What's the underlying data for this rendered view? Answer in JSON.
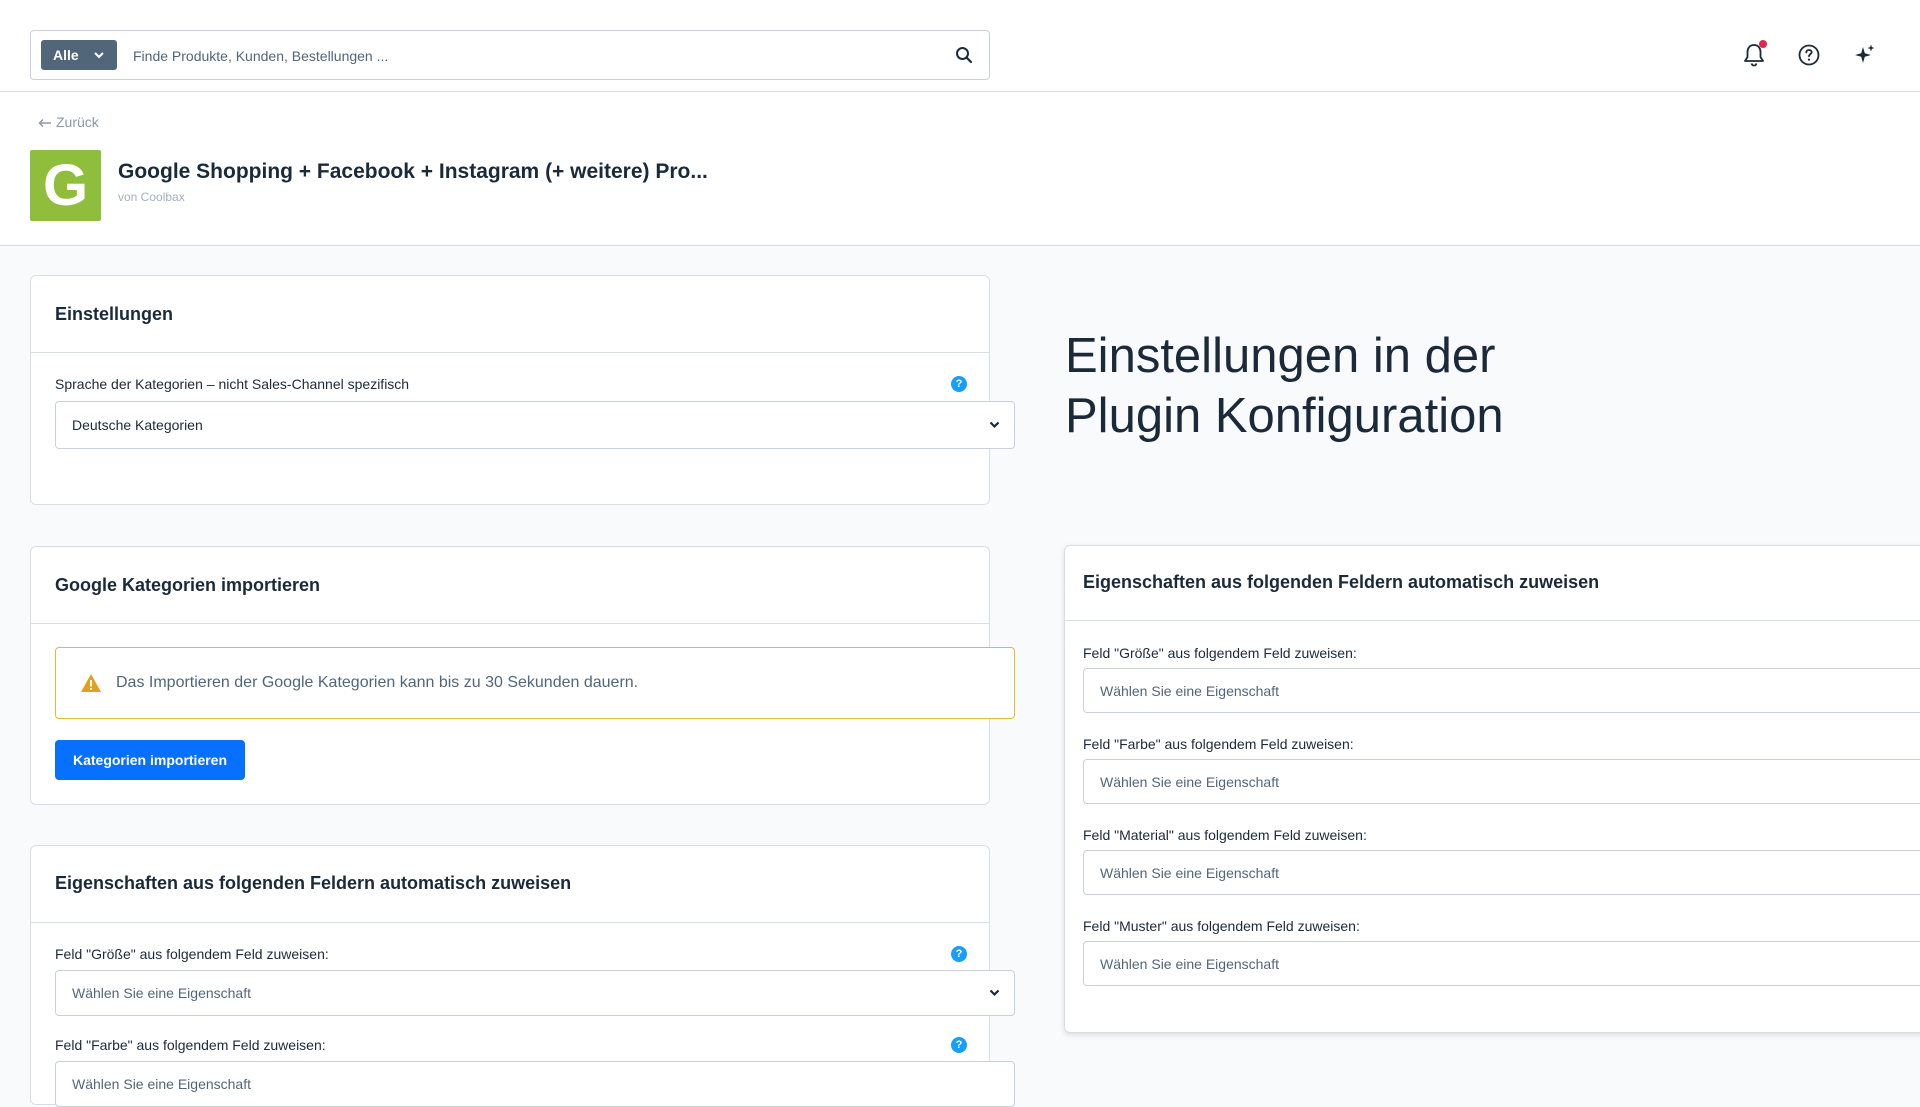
{
  "search": {
    "scope_label": "Alle",
    "placeholder": "Finde Produkte, Kunden, Bestellungen ..."
  },
  "header": {
    "back_label": "Zurück",
    "logo_letter": "G",
    "app_title": "Google Shopping + Facebook + Instagram (+ weitere) Pro...",
    "vendor": "von Coolbax"
  },
  "settings_card": {
    "title": "Einstellungen",
    "field_label": "Sprache der Kategorien – nicht Sales-Channel spezifisch",
    "field_value": "Deutsche Kategorien"
  },
  "import_card": {
    "title": "Google Kategorien importieren",
    "alert_text": "Das Importieren der Google Kategorien kann bis zu 30 Sekunden dauern.",
    "button_label": "Kategorien importieren"
  },
  "properties_card": {
    "title": "Eigenschaften aus folgenden Feldern automatisch zuweisen",
    "fields": [
      {
        "label": "Feld \"Größe\" aus folgendem Feld zuweisen:",
        "placeholder": "Wählen Sie eine Eigenschaft"
      },
      {
        "label": "Feld \"Farbe\" aus folgendem Feld zuweisen:",
        "placeholder": "Wählen Sie eine Eigenschaft"
      }
    ]
  },
  "headline": {
    "line1": "Einstellungen in der",
    "line2": "Plugin Konfiguration"
  },
  "zoom_card": {
    "title": "Eigenschaften aus folgenden Feldern automatisch zuweisen",
    "fields": [
      {
        "label": "Feld \"Größe\" aus folgendem Feld zuweisen:",
        "placeholder": "Wählen Sie eine Eigenschaft"
      },
      {
        "label": "Feld \"Farbe\" aus folgendem Feld zuweisen:",
        "placeholder": "Wählen Sie eine Eigenschaft"
      },
      {
        "label": "Feld \"Material\" aus folgendem Feld zuweisen:",
        "placeholder": "Wählen Sie eine Eigenschaft"
      },
      {
        "label": "Feld \"Muster\" aus folgendem Feld zuweisen:",
        "placeholder": "Wählen Sie eine Eigenschaft"
      }
    ]
  },
  "help_glyph": "?",
  "icons": [
    "search-icon",
    "bell-icon",
    "help-circle-icon",
    "sparkle-icon",
    "arrow-left-icon",
    "chevron-down-icon",
    "warning-icon"
  ],
  "colors": {
    "primary": "#0870ff",
    "help": "#189eff",
    "warning": "#e5b835",
    "logo": "#8fbd3c",
    "notification": "#de294c",
    "scope_button": "#52667a"
  }
}
